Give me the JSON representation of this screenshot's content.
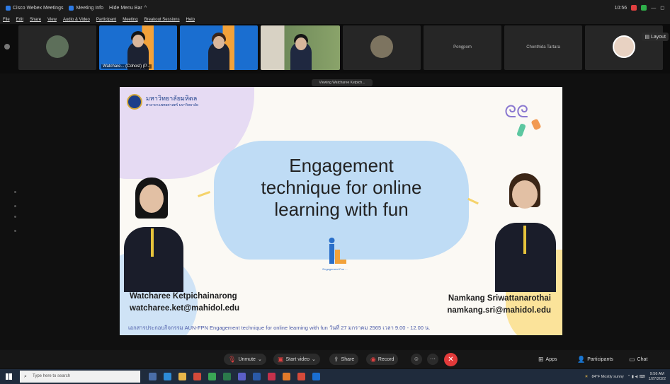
{
  "titlebar": {
    "app_title": "Cisco Webex Meetings",
    "meeting_info": "Meeting Info",
    "hide_menu": "Hide Menu Bar",
    "time": "10:56"
  },
  "menubar": [
    "File",
    "Edit",
    "Share",
    "View",
    "Audio & Video",
    "Participant",
    "Meeting",
    "Breakout Sessions",
    "Help"
  ],
  "participants": [
    {
      "label": ""
    },
    {
      "label": "Watchare... (Cohost) (P..."
    },
    {
      "label": ""
    },
    {
      "label": ""
    },
    {
      "label": ""
    },
    {
      "label": "Pongpom"
    },
    {
      "label": "Chonthida Tartara"
    },
    {
      "label": ""
    }
  ],
  "layout_label": "Layout",
  "viewing_label": "Viewing Watcharee Ketpich...",
  "slide": {
    "university_name": "มหาวิทยาลัยมหิดล",
    "university_sub": "ศาลายาแพทยศาสตร์ มหาวิทยาลัย",
    "title_line1": "Engagement",
    "title_line2": "technique for online",
    "title_line3": "learning with fun",
    "logo_caption": "Engagement Fun ...",
    "presenter_left_name": "Watcharee Ketpichainarong",
    "presenter_left_email": "watcharee.ket@mahidol.edu",
    "presenter_right_name": "Namkang Sriwattanarothai",
    "presenter_right_email": "namkang.sri@mahidol.edu",
    "footer": "เอกสารประกอบกิจกรรม AUN-FPN Engagement technique for online learning with fun วันที่ 27 มกราคม 2565 เวลา 9.00 - 12.00 น."
  },
  "controls": {
    "unmute": "Unmute",
    "start_video": "Start video",
    "share": "Share",
    "record": "Record",
    "apps": "Apps",
    "participants": "Participants",
    "chat": "Chat"
  },
  "taskbar": {
    "search_placeholder": "Type here to search",
    "weather": "84°F Mostly sunny",
    "clock_time": "9:56 AM",
    "clock_date": "1/27/2022"
  },
  "colors": {
    "end_button": "#e23a3a",
    "accent_blue": "#1a6ed0",
    "slide_bg": "#fbf9f4",
    "cloud": "#bfdcf5"
  }
}
